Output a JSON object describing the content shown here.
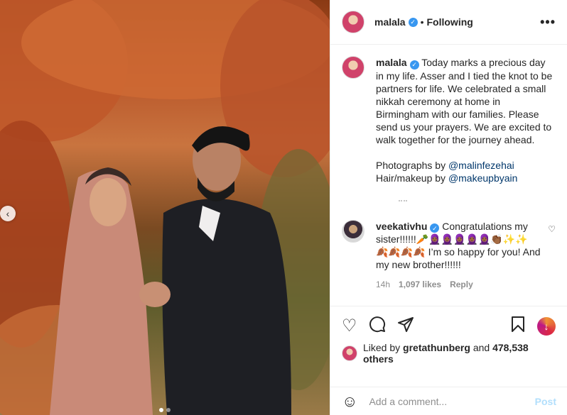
{
  "post": {
    "image_alt": "",
    "slides_total": 2,
    "slide_active": 1
  },
  "header": {
    "username": "malala",
    "separator": "•",
    "follow_status": "Following",
    "more_label": "•••"
  },
  "caption": {
    "username": "malala",
    "text": "Today marks a precious day in my life. Asser and I tied the knot to be partners for life. We celebrated a small nikkah ceremony at home in Birmingham with our families. Please send us your prayers. We are excited to walk together for the journey ahead.",
    "credit1_prefix": "Photographs by ",
    "credit1_handle": "@malinfezehai",
    "credit2_prefix": "Hair/makeup by ",
    "credit2_handle": "@makeupbyain"
  },
  "comment": {
    "username": "veekativhu",
    "text": "Congratulations my sister!!!!!!🥕🧕🏾🧕🏾🧕🏾🧕🏾🧕🏾👏🏾✨✨ 🍂🍂🍂🍂 I’m so happy for you! And my new brother!!!!!!",
    "time": "14h",
    "likes": "1,097 likes",
    "reply_label": "Reply"
  },
  "likes": {
    "prefix": "Liked by ",
    "user": "gretathunberg",
    "middle": " and ",
    "count": "478,538 others"
  },
  "timestamp": "",
  "add_comment": {
    "placeholder": "Add a comment...",
    "post_label": "Post"
  },
  "icons": {
    "heart": "heart-icon",
    "comment": "comment-icon",
    "share": "paper-plane-icon",
    "save": "bookmark-icon"
  },
  "colors": {
    "verified": "#3897f0",
    "link": "#00376b",
    "post_disabled": "#b2dffc"
  }
}
